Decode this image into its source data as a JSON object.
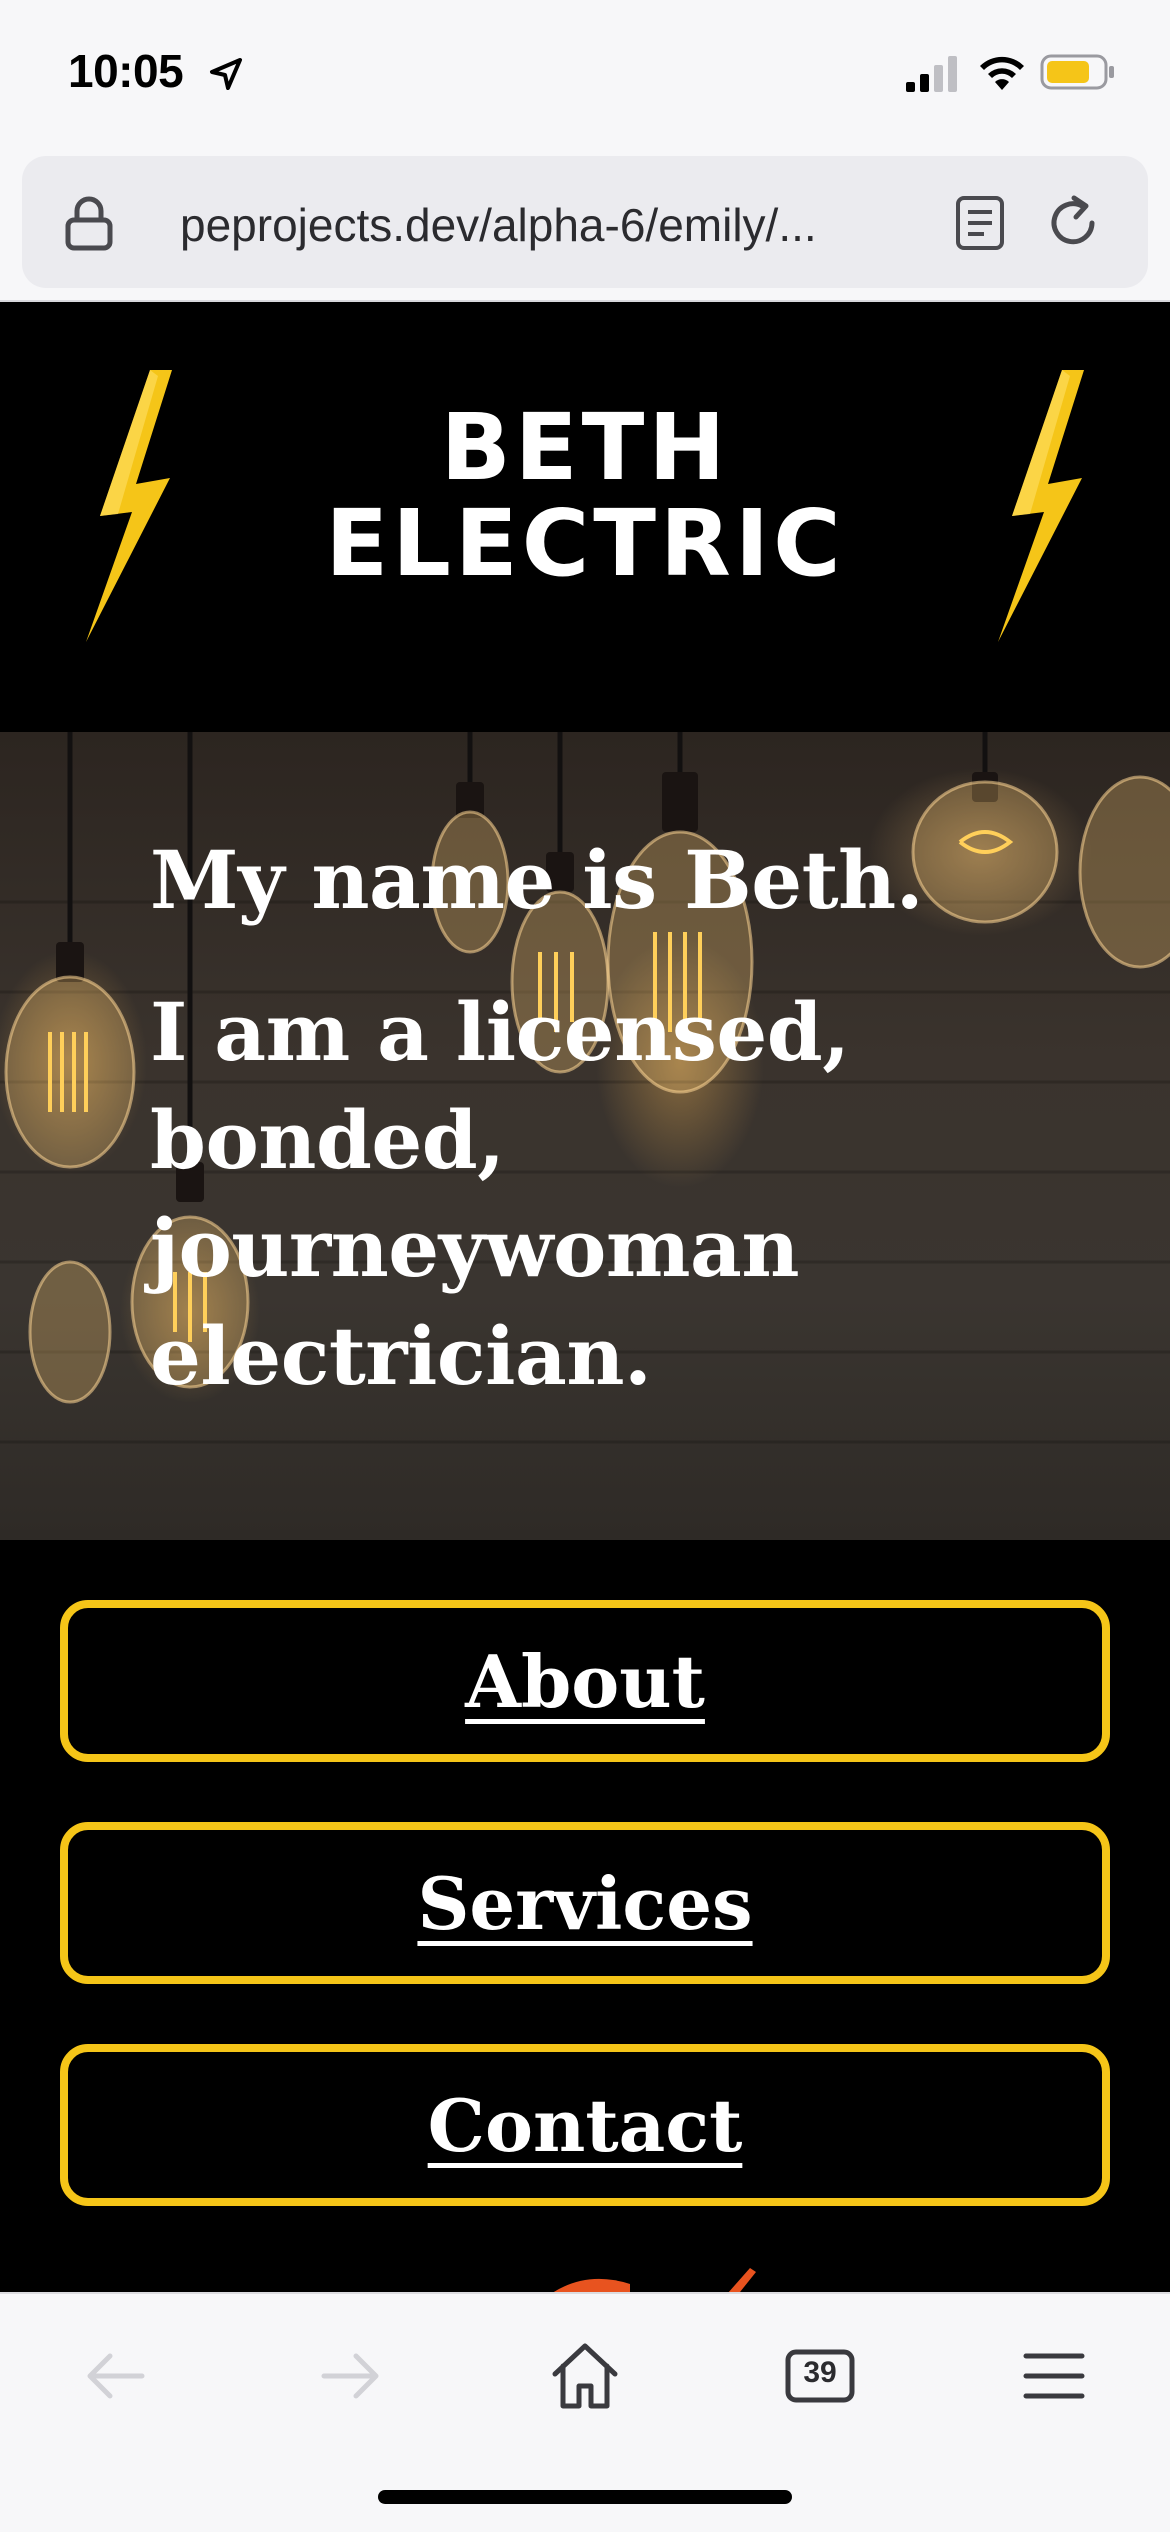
{
  "status_bar": {
    "time": "10:05",
    "icons": [
      "location-arrow-icon",
      "signal-icon",
      "wifi-icon",
      "battery-icon"
    ],
    "battery_color": "#f5c518"
  },
  "browser": {
    "url": "peprojects.dev/alpha-6/emily/...",
    "tab_count": "39",
    "toolbar_icons": [
      "back-icon",
      "forward-icon",
      "home-icon",
      "tabs-icon",
      "menu-icon"
    ]
  },
  "site": {
    "brand_line_1": "BETH",
    "brand_line_2": "ELECTRIC",
    "hero_line_1": "My name is Beth.",
    "hero_line_2": "I am a licensed, bonded, journeywoman electrician.",
    "nav": [
      {
        "label": "About"
      },
      {
        "label": "Services"
      },
      {
        "label": "Contact"
      }
    ],
    "colors": {
      "accent": "#f5c518",
      "background": "#000000",
      "text": "#ffffff"
    }
  }
}
